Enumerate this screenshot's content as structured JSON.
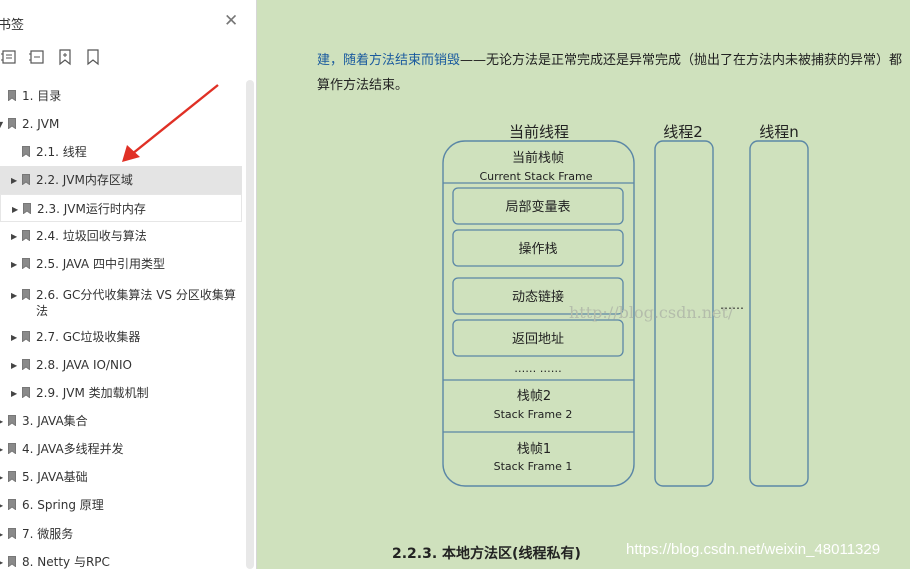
{
  "sidebar": {
    "title": "书签",
    "items": [
      {
        "label": "1. 目录",
        "level": 0,
        "arrow": false
      },
      {
        "label": "2. JVM",
        "level": 0,
        "arrow": "down"
      },
      {
        "label": "2.1. 线程",
        "level": 1,
        "arrow": false
      },
      {
        "label": "2.2. JVM内存区域",
        "level": 1,
        "arrow": "right",
        "selected": true
      },
      {
        "label": "2.3. JVM运行时内存",
        "level": 1,
        "arrow": "right",
        "hover": true
      },
      {
        "label": "2.4. 垃圾回收与算法",
        "level": 1,
        "arrow": "right"
      },
      {
        "label": "2.5. JAVA 四中引用类型",
        "level": 1,
        "arrow": "right"
      },
      {
        "label": "2.6. GC分代收集算法  VS 分区收集算法",
        "level": 1,
        "arrow": "right",
        "wrap": true
      },
      {
        "label": "2.7. GC垃圾收集器",
        "level": 1,
        "arrow": "right"
      },
      {
        "label": "2.8.  JAVA IO/NIO",
        "level": 1,
        "arrow": "right"
      },
      {
        "label": "2.9. JVM 类加载机制",
        "level": 1,
        "arrow": "right"
      },
      {
        "label": "3. JAVA集合",
        "level": 0,
        "arrow": "right"
      },
      {
        "label": "4. JAVA多线程并发",
        "level": 0,
        "arrow": "right"
      },
      {
        "label": "5. JAVA基础",
        "level": 0,
        "arrow": "right"
      },
      {
        "label": "6. Spring 原理",
        "level": 0,
        "arrow": "right"
      },
      {
        "label": "7.   微服务",
        "level": 0,
        "arrow": "right"
      },
      {
        "label": "8. Netty 与RPC",
        "level": 0,
        "arrow": "right"
      }
    ]
  },
  "document": {
    "para_blue": "建，随着方法结束而销毁",
    "para_rest": "——无论方法是正常完成还是异常完成（抛出了在方法内未被捕获的异常）都算作方法结束。",
    "heading": "2.2.3.  本地方法区(线程私有)"
  },
  "diagram": {
    "thread1": "当前线程",
    "thread2": "线程2",
    "threadn": "线程n",
    "current_frame_cn": "当前栈帧",
    "current_frame_en": "Current Stack Frame",
    "boxes": [
      "局部变量表",
      "操作栈",
      "动态链接",
      "返回地址"
    ],
    "ellipsis_inner": "…… ……",
    "frame2_cn": "栈帧2",
    "frame2_en": "Stack Frame 2",
    "frame1_cn": "栈帧1",
    "frame1_en": "Stack Frame 1",
    "ellipsis_between": "……",
    "stroke_color": "#5b87a6"
  },
  "watermarks": {
    "center": "http://blog.csdn.net/",
    "corner": "https://blog.csdn.net/weixin_48011329"
  },
  "colors": {
    "doc_background": "#cfe1bd",
    "arrow_red": "#e03025",
    "selected_row": "#e4e4e4"
  }
}
